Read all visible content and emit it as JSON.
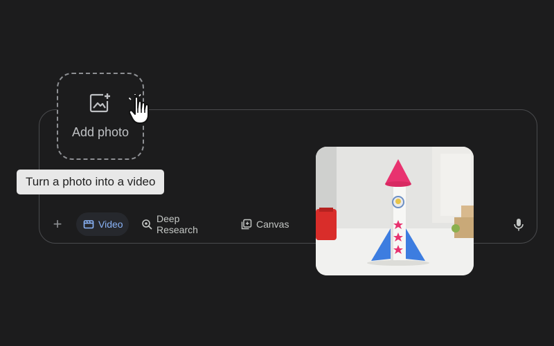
{
  "add_photo": {
    "label": "Add photo",
    "icon": "add-image-icon"
  },
  "tooltip": {
    "text": "Turn a photo into a video"
  },
  "toolbar": {
    "plus_label": "+",
    "tools": [
      {
        "label": "Video",
        "icon": "clapperboard-icon",
        "active": true
      },
      {
        "label": "Deep Research",
        "icon": "deep-research-icon",
        "active": false
      },
      {
        "label": "Canvas",
        "icon": "canvas-icon",
        "active": false
      }
    ],
    "mic_icon": "microphone-icon"
  },
  "photo": {
    "subject": "paper-tube-rocket-photo"
  },
  "colors": {
    "background": "#1c1c1d",
    "accent": "#8ab4f8",
    "active_chip": "#26282d",
    "tooltip_bg": "#e8e8e8"
  }
}
